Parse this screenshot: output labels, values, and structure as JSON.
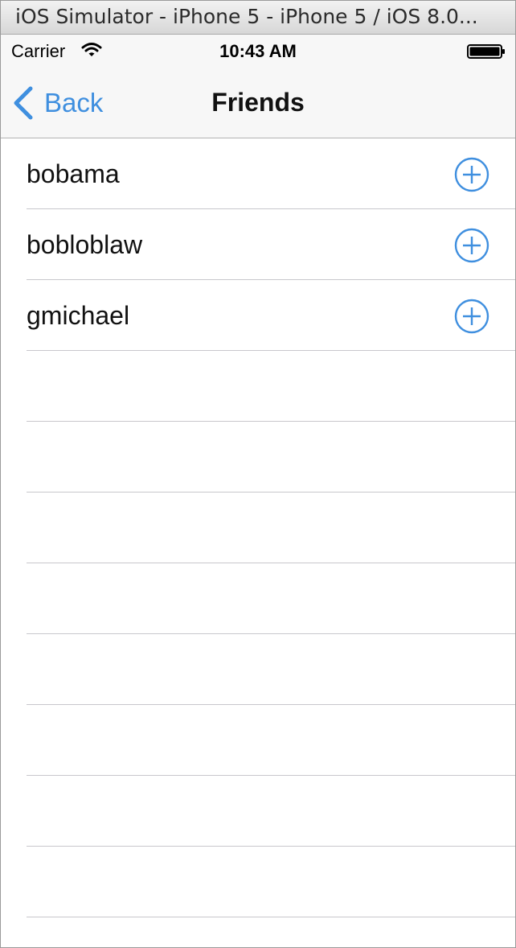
{
  "window": {
    "title": "iOS Simulator - iPhone 5 - iPhone 5 / iOS 8.0..."
  },
  "status_bar": {
    "carrier": "Carrier",
    "time": "10:43 AM",
    "icons": [
      "wifi-icon",
      "battery-icon"
    ]
  },
  "nav_bar": {
    "back_label": "Back",
    "back_icon": "chevron-left-icon",
    "title": "Friends"
  },
  "friends": [
    {
      "username": "bobama",
      "action_icon": "add-circle-icon"
    },
    {
      "username": "bobloblaw",
      "action_icon": "add-circle-icon"
    },
    {
      "username": "gmichael",
      "action_icon": "add-circle-icon"
    }
  ],
  "empty_row_count": 9,
  "colors": {
    "tint": "#3f8fdf",
    "separator": "#c8c7cc",
    "bar_background": "#f7f7f7"
  }
}
